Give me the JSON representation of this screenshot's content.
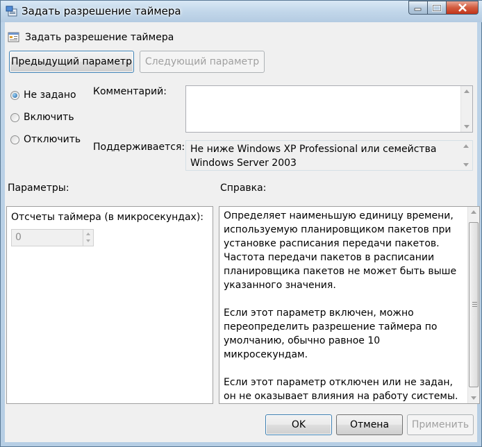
{
  "window": {
    "title": "Задать разрешение таймера"
  },
  "header": {
    "title": "Задать разрешение таймера"
  },
  "nav": {
    "prev_label": "Предыдущий параметр",
    "next_label": "Следующий параметр"
  },
  "state": {
    "options": [
      {
        "label": "Не задано",
        "selected": true
      },
      {
        "label": "Включить",
        "selected": false
      },
      {
        "label": "Отключить",
        "selected": false
      }
    ]
  },
  "comment": {
    "label": "Комментарий:",
    "value": ""
  },
  "supported": {
    "label": "Поддерживается:",
    "value": "Не ниже Windows XP Professional или семейства Windows Server 2003"
  },
  "options_section": {
    "label": "Параметры:",
    "field_label": "Отсчеты таймера (в микросекундах):",
    "field_value": "0"
  },
  "help": {
    "label": "Справка:",
    "text": "Определяет наименьшую единицу времени, используемую планировщиком пакетов при установке расписания передачи пакетов. Частота передачи пакетов в расписании планировщика пакетов не может быть выше указанного значения.\n\nЕсли этот параметр включен, можно переопределить разрешение таймера по умолчанию, обычно равное 10 микросекундам.\n\nЕсли этот параметр отключен или не задан, он не оказывает влияния на работу системы."
  },
  "footer": {
    "ok_label": "OK",
    "cancel_label": "Отмена",
    "apply_label": "Применить"
  },
  "colors": {
    "window_frame": "#bcd3e8",
    "close_button": "#c2341a",
    "client_bg": "#f0f0f0"
  }
}
